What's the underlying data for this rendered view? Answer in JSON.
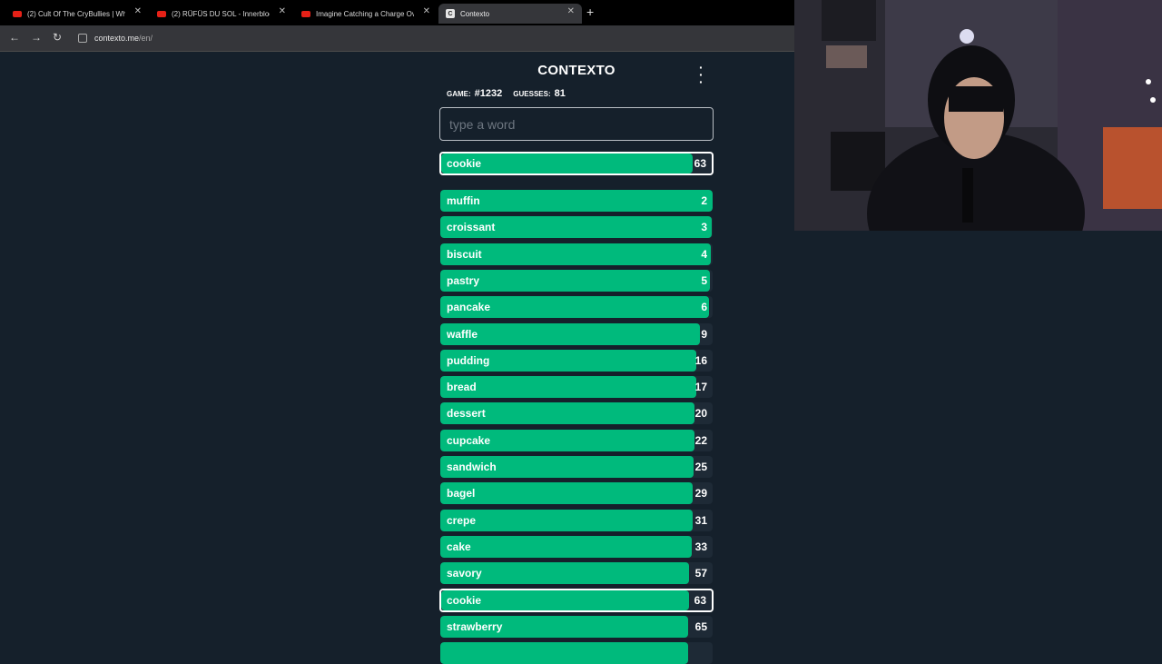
{
  "browser": {
    "tabs": [
      {
        "label": "(2) Cult Of The CryBullies | Why",
        "favicon": "youtube-icon"
      },
      {
        "label": "(2) RÜFÜS DU SOL - Innerbloom",
        "favicon": "youtube-icon"
      },
      {
        "label": "Imagine Catching a Charge Ove",
        "favicon": "youtube-icon"
      },
      {
        "label": "Contexto",
        "favicon": "contexto-icon",
        "active": true
      }
    ],
    "url_domain": "contexto.me",
    "url_path": "/en/",
    "favicon_letter": "C"
  },
  "game": {
    "title": "CONTEXTO",
    "game_label": "GAME:",
    "game_number": "#1232",
    "guesses_label": "GUESSES:",
    "guesses_count": "81",
    "input_placeholder": "type a word",
    "last_guess": {
      "word": "cookie",
      "distance": "63"
    },
    "guesses": [
      {
        "word": "muffin",
        "distance": "2"
      },
      {
        "word": "croissant",
        "distance": "3"
      },
      {
        "word": "biscuit",
        "distance": "4"
      },
      {
        "word": "pastry",
        "distance": "5"
      },
      {
        "word": "pancake",
        "distance": "6"
      },
      {
        "word": "waffle",
        "distance": "9"
      },
      {
        "word": "pudding",
        "distance": "16"
      },
      {
        "word": "bread",
        "distance": "17"
      },
      {
        "word": "dessert",
        "distance": "20"
      },
      {
        "word": "cupcake",
        "distance": "22"
      },
      {
        "word": "sandwich",
        "distance": "25"
      },
      {
        "word": "bagel",
        "distance": "29"
      },
      {
        "word": "crepe",
        "distance": "31"
      },
      {
        "word": "cake",
        "distance": "33"
      },
      {
        "word": "savory",
        "distance": "57"
      },
      {
        "word": "cookie",
        "distance": "63",
        "highlight": true
      },
      {
        "word": "strawberry",
        "distance": "65"
      },
      {
        "word": "",
        "distance": ""
      }
    ]
  },
  "colors": {
    "bar": "#00ba7c",
    "background": "#15202b"
  }
}
